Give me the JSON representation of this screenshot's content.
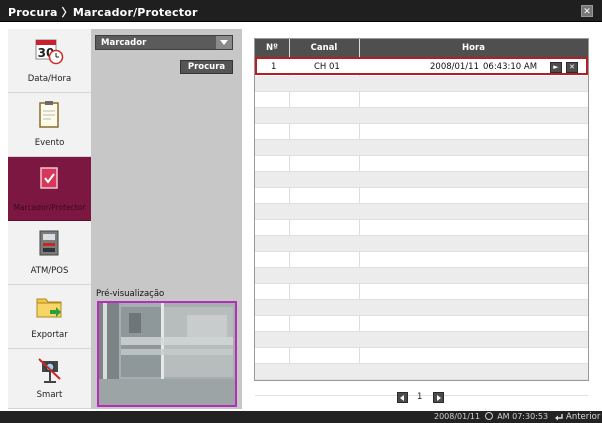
{
  "window": {
    "title": "Procura 〉Marcador/Protector",
    "close_icon": "close-icon"
  },
  "sidebar": {
    "items": [
      {
        "label": "Data/Hora",
        "icon": "calendar-clock-icon",
        "calendar_day": "30",
        "active": false
      },
      {
        "label": "Evento",
        "icon": "event-clipboard-icon",
        "active": false
      },
      {
        "label": "Marcador/Protector",
        "icon": "bookmark-protector-icon",
        "active": true
      },
      {
        "label": "ATM/POS",
        "icon": "atm-pos-icon",
        "active": false
      },
      {
        "label": "Exportar",
        "icon": "export-folder-icon",
        "active": false
      },
      {
        "label": "Smart",
        "icon": "smart-camera-icon",
        "active": false
      }
    ]
  },
  "search": {
    "type_selected": "Marcador",
    "search_button": "Procura",
    "preview_label": "Pré-visualização"
  },
  "table": {
    "columns": [
      "Nº",
      "Canal",
      "Hora"
    ],
    "rows": [
      {
        "no": "1",
        "channel": "CH 01",
        "date": "2008/01/11",
        "time": "06:43:10 AM",
        "selected": true
      }
    ],
    "empty_rows": 20
  },
  "pagination": {
    "current_page": "1"
  },
  "status": {
    "date": "2008/01/11",
    "time": "AM 07:30:53",
    "back_label": "Anterior"
  },
  "colors": {
    "titlebar": "#1f1f1f",
    "active_item": "#7b1740",
    "selected_row_border": "#b51e24",
    "preview_border": "#b42fb8"
  }
}
